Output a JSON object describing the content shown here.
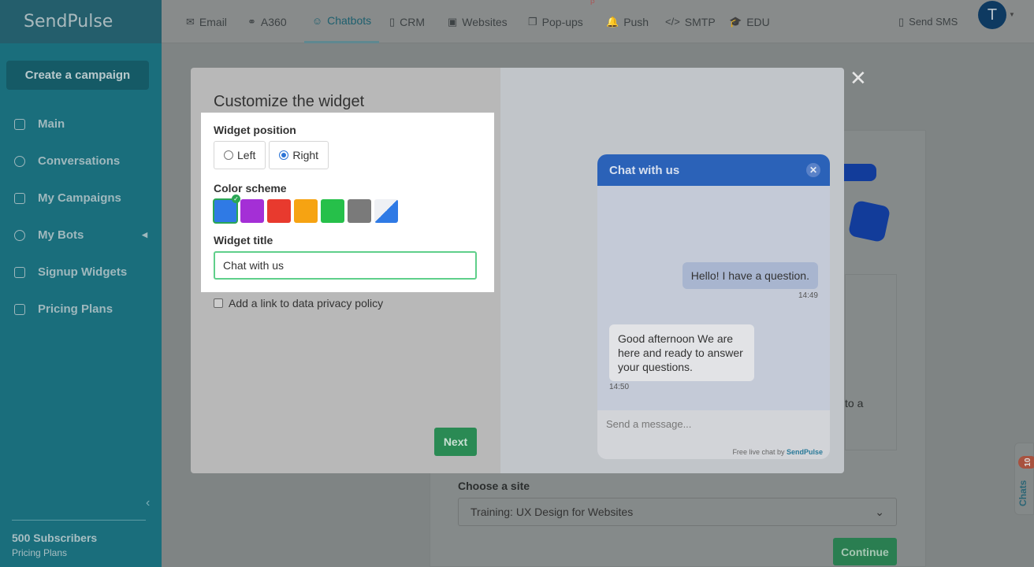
{
  "brand": {
    "logo": "SendPulse"
  },
  "sidebar": {
    "create_label": "Create a campaign",
    "items": [
      {
        "label": "Main"
      },
      {
        "label": "Conversations"
      },
      {
        "label": "My Campaigns"
      },
      {
        "label": "My Bots"
      },
      {
        "label": "Signup Widgets"
      },
      {
        "label": "Pricing Plans"
      }
    ],
    "subscribers": "500 Subscribers",
    "plan_link": "Pricing Plans"
  },
  "topnav": {
    "items": [
      {
        "label": "Email",
        "icon": "✉"
      },
      {
        "label": "A360",
        "icon": "⚭"
      },
      {
        "label": "Chatbots",
        "icon": "☺"
      },
      {
        "label": "CRM",
        "icon": "▯"
      },
      {
        "label": "Websites",
        "icon": "▣"
      },
      {
        "label": "Pop-ups",
        "icon": "❐"
      },
      {
        "label": "Push",
        "icon": "🔔"
      },
      {
        "label": "SMTP",
        "icon": "</>"
      },
      {
        "label": "EDU",
        "icon": "🎓"
      }
    ],
    "beta": "β",
    "send_sms": "Send SMS",
    "avatar": "T"
  },
  "modal": {
    "title": "Customize the widget",
    "position_label": "Widget position",
    "positions": [
      "Left",
      "Right"
    ],
    "selected_position": "Right",
    "color_label": "Color scheme",
    "colors": [
      "#2f7ae5",
      "#a42fd6",
      "#e83a2e",
      "#f6a312",
      "#26c04a",
      "#7a7a7a",
      "gradient"
    ],
    "selected_color": "#2f7ae5",
    "widget_title_label": "Widget title",
    "widget_title_value": "Chat with us",
    "privacy_label": "Add a link to data privacy policy",
    "next_label": "Next"
  },
  "preview": {
    "header": "Chat with us",
    "msg_user": "Hello! I have a question.",
    "msg_user_time": "14:49",
    "msg_bot": "Good afternoon We are here and ready to answer your questions.",
    "msg_bot_time": "14:50",
    "input_placeholder": "Send a message...",
    "footer_prefix": "Free live chat by",
    "footer_brand": "SendPulse"
  },
  "page": {
    "partial_text": "to a",
    "choose_site_label": "Choose a site",
    "site_value": "Training: UX Design for Websites",
    "continue_label": "Continue",
    "chats_label": "Chats",
    "chats_count": "10"
  }
}
